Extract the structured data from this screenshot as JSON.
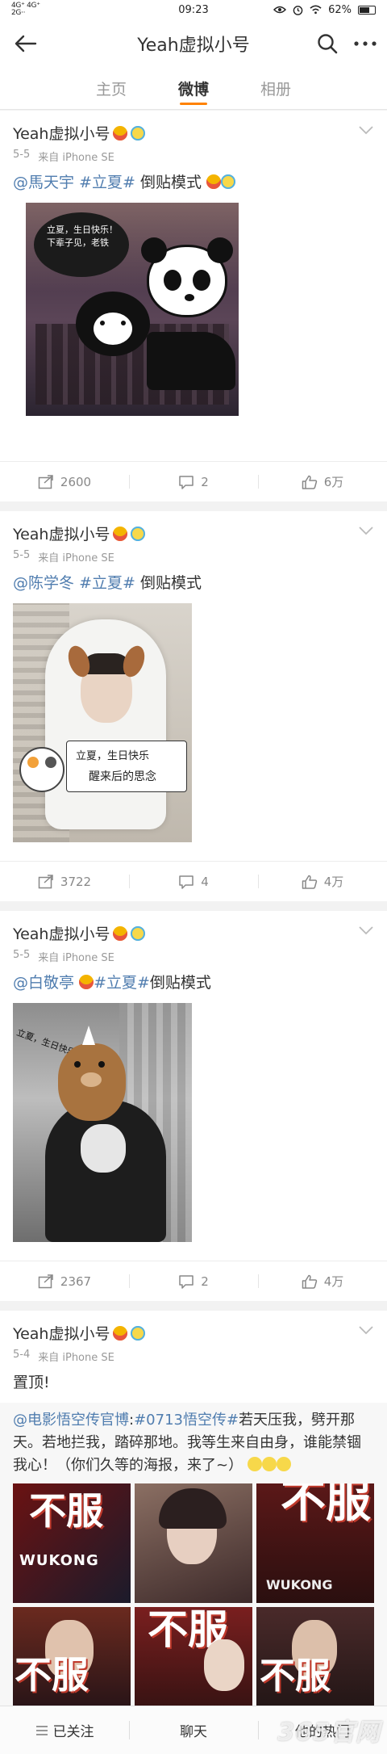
{
  "status": {
    "network_line1": "4G⁺ 4G⁺",
    "network_line2": "2G··",
    "time": "09:23",
    "battery": "62%"
  },
  "header": {
    "title": "Yeah虚拟小号"
  },
  "tabs": [
    {
      "label": "主页"
    },
    {
      "label": "微博"
    },
    {
      "label": "相册"
    }
  ],
  "posts": [
    {
      "user": "Yeah虚拟小号",
      "date": "5-5",
      "source": "来自 iPhone SE",
      "mention": "@馬天宇",
      "tag": "#立夏#",
      "text": " 倒贴模式",
      "image_caption": "立夏，生日快乐！下辈子见，老铁",
      "reposts": "2600",
      "comments": "2",
      "likes": "6万"
    },
    {
      "user": "Yeah虚拟小号",
      "date": "5-5",
      "source": "来自 iPhone SE",
      "mention": "@陈学冬",
      "tag": "#立夏#",
      "text": " 倒贴模式",
      "image_caption_1": "立夏，生日快乐",
      "image_caption_2": "醒来后的思念",
      "reposts": "3722",
      "comments": "4",
      "likes": "4万"
    },
    {
      "user": "Yeah虚拟小号",
      "date": "5-5",
      "source": "来自 iPhone SE",
      "mention": "@白敬亭",
      "tag": "#立夏#",
      "text": "倒贴模式",
      "image_caption": "立夏，生日快乐",
      "reposts": "2367",
      "comments": "2",
      "likes": "4万"
    },
    {
      "user": "Yeah虚拟小号",
      "date": "5-4",
      "source": "来自 iPhone SE",
      "text": "置顶!",
      "repost_mention": "@电影悟空传官博",
      "repost_tag": "#0713悟空传#",
      "repost_text": "若天压我，劈开那天。若地拦我，踏碎那地。我等生来自由身，谁能禁锢我心！（你们久等的海报，来了~）",
      "poster_texts": [
        "不服",
        "不服",
        "不服",
        "不服",
        "不服",
        "不服"
      ],
      "poster_sub_1": "WUKONG",
      "poster_sub_2": "WUKONG"
    }
  ],
  "bottom": {
    "follow": "已关注",
    "chat": "聊天",
    "hot": "他的热门",
    "watermark": "365官网"
  },
  "colors": {
    "accent": "#ff8200",
    "link": "#507daf"
  }
}
